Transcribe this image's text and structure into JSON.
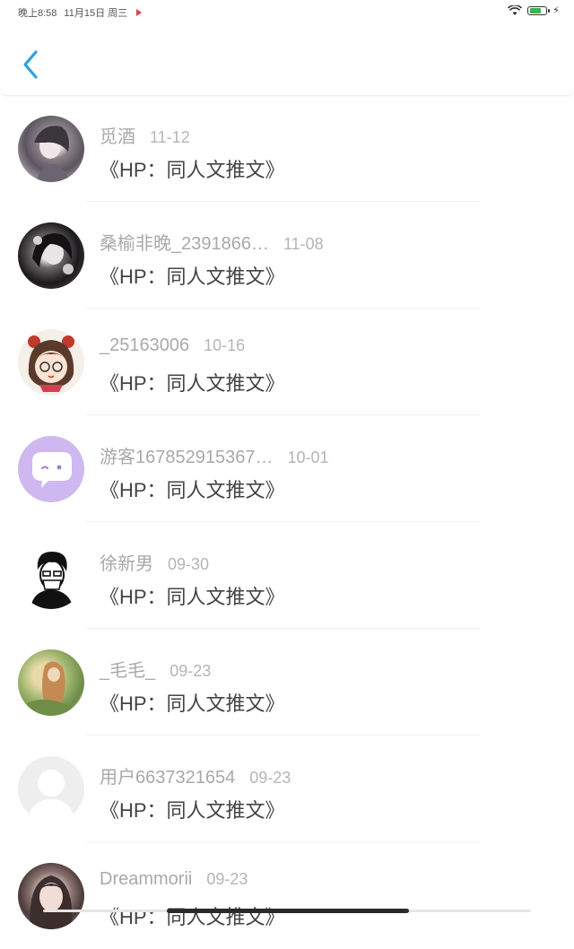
{
  "status_bar": {
    "time": "晚上8:58",
    "date": "11月15日 周三"
  },
  "header": {
    "back_icon": "chevron-left-icon",
    "accent_color": "#2aa0e0"
  },
  "items": [
    {
      "name": "觅酒",
      "date": "11-12",
      "text": "《HP：同人文推文》",
      "avatar": "avatar-photo-girl"
    },
    {
      "name": "桑榆非晚_2391866…",
      "date": "11-08",
      "text": "《HP：同人文推文》",
      "avatar": "avatar-photo-dark"
    },
    {
      "name": "_25163006",
      "date": "10-16",
      "text": "《HP：同人文推文》",
      "avatar": "avatar-cartoon-girl"
    },
    {
      "name": "游客167852915367…",
      "date": "10-01",
      "text": "《HP：同人文推文》",
      "avatar": "avatar-chat-bubble"
    },
    {
      "name": "徐新男",
      "date": "09-30",
      "text": "《HP：同人文推文》",
      "avatar": "avatar-cartoon-boy"
    },
    {
      "name": "_毛毛_",
      "date": "09-23",
      "text": "《HP：同人文推文》",
      "avatar": "avatar-painting"
    },
    {
      "name": "用户6637321654",
      "date": "09-23",
      "text": "《HP：同人文推文》",
      "avatar": "avatar-default"
    },
    {
      "name": "Dreammorii",
      "date": "09-23",
      "text": "《HP：同人文推文》",
      "avatar": "avatar-illustration-girl"
    }
  ]
}
